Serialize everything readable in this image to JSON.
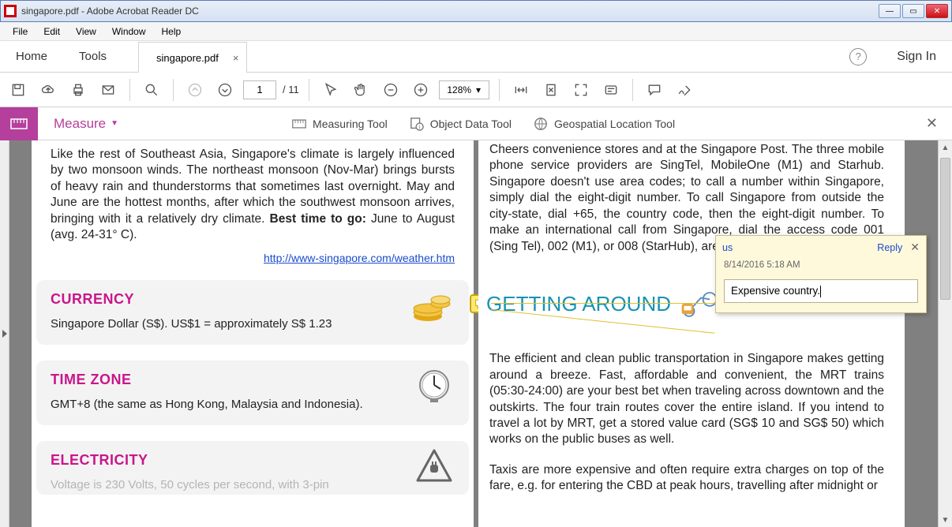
{
  "window": {
    "title": "singapore.pdf - Adobe Acrobat Reader DC"
  },
  "menu": [
    "File",
    "Edit",
    "View",
    "Window",
    "Help"
  ],
  "app_tabs": {
    "home": "Home",
    "tools": "Tools",
    "doc": "singapore.pdf",
    "signin": "Sign In"
  },
  "toolbar": {
    "page_current": "1",
    "page_total": "/ 11",
    "zoom": "128%"
  },
  "measure": {
    "title": "Measure",
    "tools": {
      "measuring": "Measuring Tool",
      "object": "Object Data Tool",
      "geo": "Geospatial Location Tool"
    }
  },
  "doc": {
    "climate_text": "Like the rest of Southeast Asia, Singapore's climate is largely influenced by two monsoon winds. The northeast monsoon (Nov-Mar) brings bursts of heavy rain and thunderstorms that sometimes last overnight. May and June are the hottest months, after which the southwest monsoon arrives, bringing with it a relatively dry climate.",
    "best_time_label": "Best time to go: ",
    "best_time_value": "June to August (avg. 24-31° C).",
    "weather_link": "http://www-singapore.com/weather.htm",
    "currency": {
      "title": "CURRENCY",
      "text": "Singapore Dollar (S$). US$1 = approximately S$ 1.23"
    },
    "timezone": {
      "title": "TIME ZONE",
      "text": "GMT+8 (the same as Hong Kong, Malaysia and Indonesia)."
    },
    "electricity": {
      "title": "ELECTRICITY",
      "text": "Voltage is 230 Volts, 50 cycles per second, with 3-pin"
    },
    "phone_text": "Cheers convenience stores and at the Singapore Post. The three mobile phone service providers are SingTel, MobileOne (M1) and Starhub. Singapore doesn't use area codes; to call a number within Singapore, simply dial the eight-digit number. To call Singapore from outside the city-state, dial +65, the country code, then the eight-digit number. To make an international call from Singapore, dial the access code 001 (Sing Tel), 002 (M1), or 008 (StarHub), area code and the number.",
    "getting_around_title": "GETTING AROUND",
    "getting_around_p1": "The efficient and clean public transportation in Singapore makes getting around a breeze. Fast, affordable and convenient, the MRT trains (05:30-24:00) are your best bet when traveling across downtown and the outskirts. The four train routes cover the entire island. If you intend to travel a lot by MRT, get a stored value card (SG$ 10 and SG$ 50) which works on the public buses as well.",
    "getting_around_p2": "Taxis are more expensive and often require extra charges on top of the fare, e.g. for entering the CBD at peak hours, travelling after midnight or"
  },
  "comment": {
    "author": "us",
    "reply": "Reply",
    "date": "8/14/2016  5:18 AM",
    "text": "Expensive country."
  }
}
